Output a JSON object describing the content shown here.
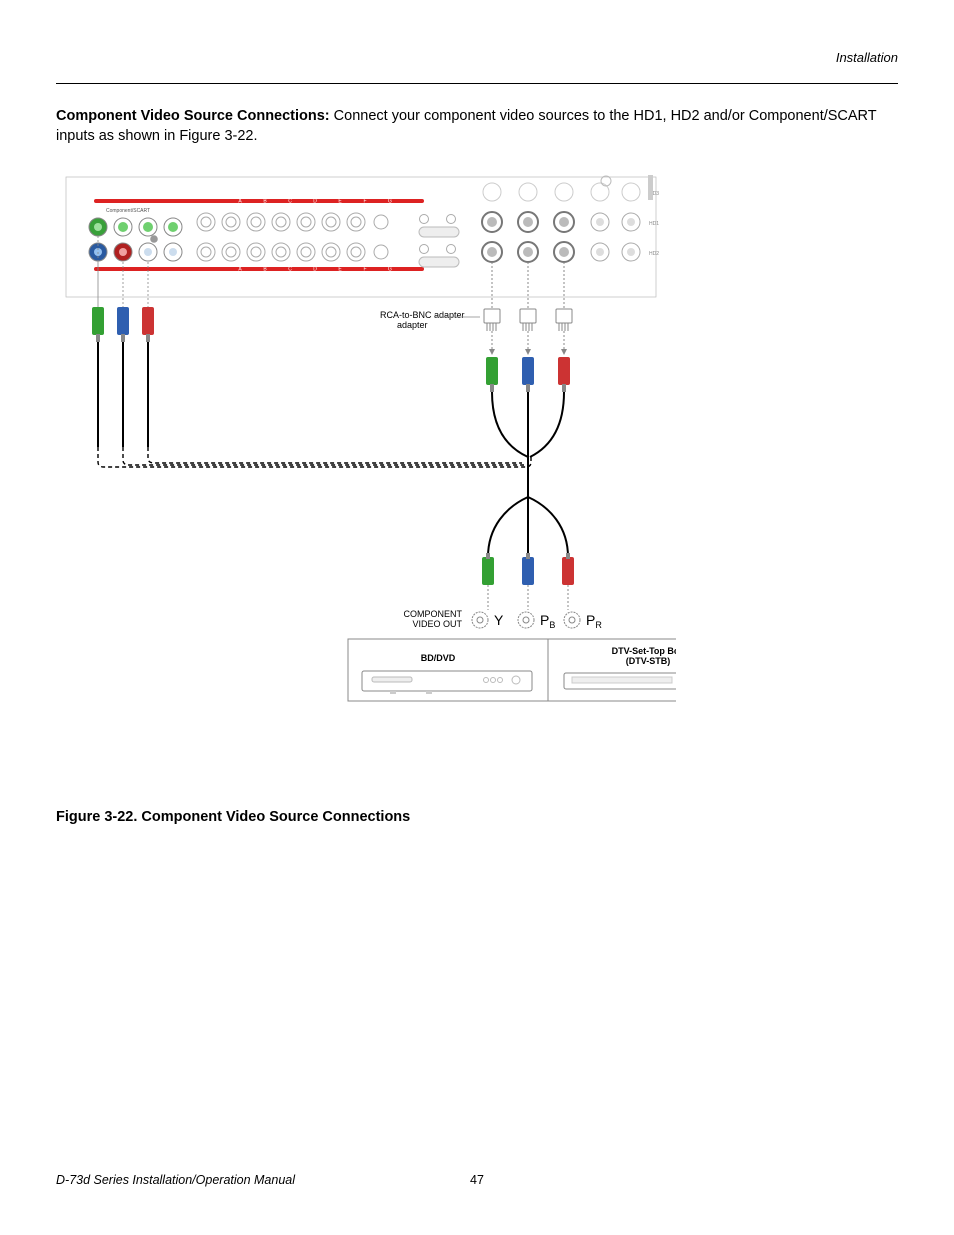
{
  "header": {
    "section": "Installation"
  },
  "paragraph": {
    "lead": "Component Video Source Connections:",
    "rest": " Connect your component video sources to the HD1, HD2 and/or Component/SCART inputs as shown in Figure 3-22."
  },
  "figure": {
    "caption": "Figure 3-22. Component Video Source Connections",
    "labels": {
      "rca_bnc": "RCA-to-BNC adapter",
      "comp_out1": "COMPONENT",
      "comp_out2": "VIDEO OUT",
      "y": "Y",
      "pb": "P",
      "pb_sub": "B",
      "pr": "P",
      "pr_sub": "R",
      "bd": "BD/DVD",
      "stb1": "DTV-Set-Top Box",
      "stb2": "(DTV-STB)",
      "comp_scart": "Component/SCART",
      "hd1": "HD1",
      "hd2": "HD2",
      "hd3": "HD3",
      "bar_a": "A",
      "bar_b": "B",
      "bar_c": "C",
      "bar_d": "D",
      "bar_e": "E",
      "bar_f": "F",
      "bar_g": "G"
    }
  },
  "footer": {
    "manual": "D-73d Series Installation/Operation Manual",
    "page": "47"
  }
}
